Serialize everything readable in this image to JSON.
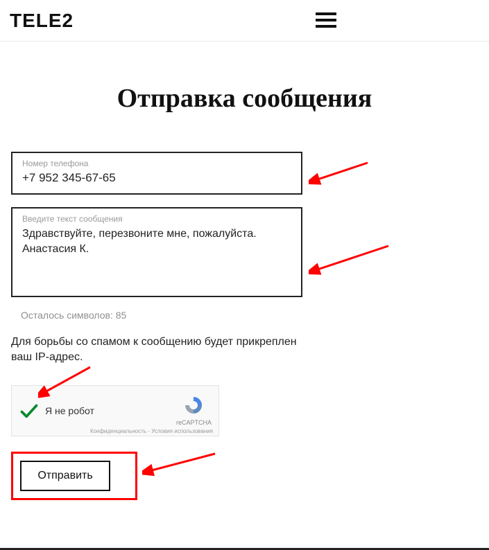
{
  "brand": "TELE2",
  "page_title": "Отправка сообщения",
  "phone": {
    "label": "Номер телефона",
    "value": "+7 952 345-67-65"
  },
  "message": {
    "label": "Введите текст сообщения",
    "value": "Здравствуйте, перезвоните мне, пожалуйста. Анастасия К."
  },
  "chars_left": "Осталось символов: 85",
  "ip_note": "Для борьбы со спамом к сообщению будет прикреплен ваш IP-адрес.",
  "recaptcha": {
    "text": "Я не робот",
    "brand": "reCAPTCHA",
    "legal": "Конфиденциальность - Условия использования"
  },
  "submit_label": "Отправить"
}
